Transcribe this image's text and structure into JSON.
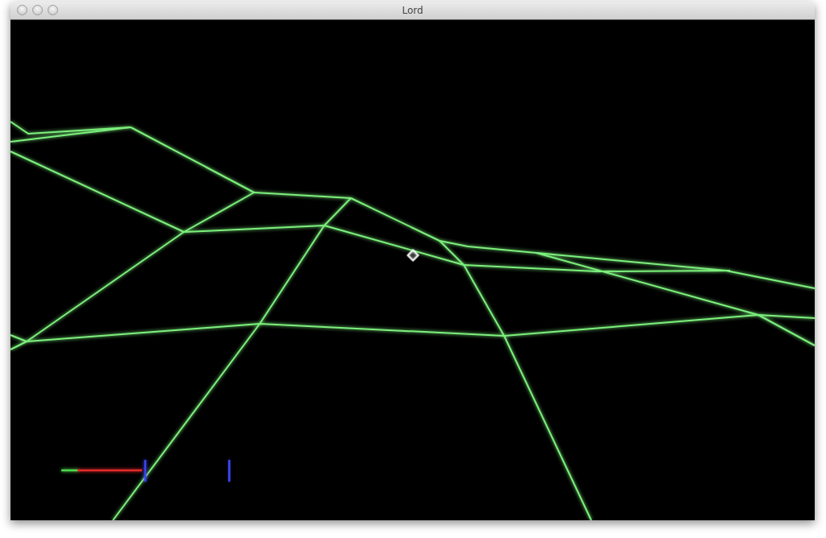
{
  "window": {
    "title": "Lord"
  }
}
